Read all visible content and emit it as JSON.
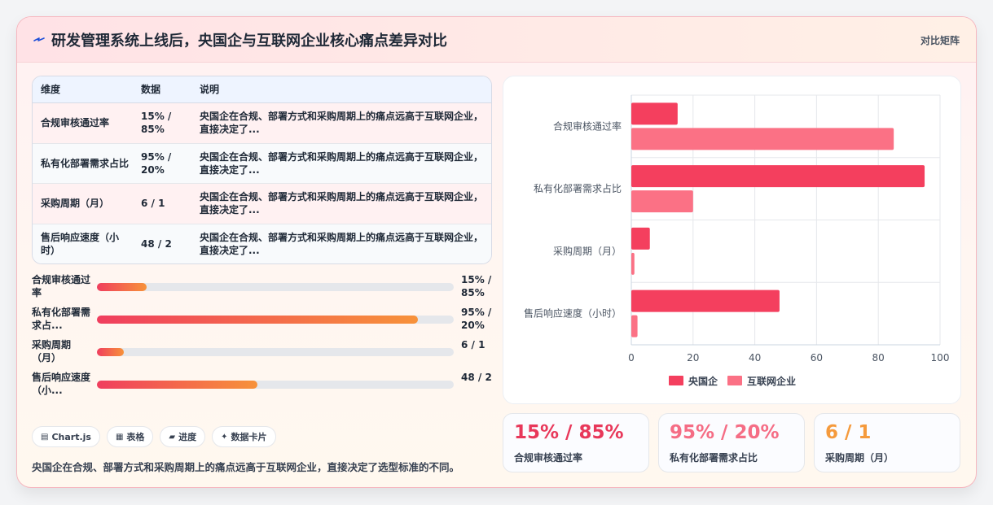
{
  "header": {
    "title": "研发管理系统上线后，央国企与互联网企业核心痛点差异对比",
    "tag": "对比矩阵",
    "title_icon": "lightning-icon"
  },
  "table": {
    "headers": [
      "维度",
      "数据",
      "说明"
    ],
    "rows": [
      {
        "dim": "合规审核通过率",
        "data": "15% / 85%",
        "desc": "央国企在合规、部署方式和采购周期上的痛点远高于互联网企业，直接决定了..."
      },
      {
        "dim": "私有化部署需求占比",
        "data": "95% / 20%",
        "desc": "央国企在合规、部署方式和采购周期上的痛点远高于互联网企业，直接决定了..."
      },
      {
        "dim": "采购周期（月）",
        "data": "6 / 1",
        "desc": "央国企在合规、部署方式和采购周期上的痛点远高于互联网企业，直接决定了..."
      },
      {
        "dim": "售后响应速度（小时）",
        "data": "48 / 2",
        "desc": "央国企在合规、部署方式和采购周期上的痛点远高于互联网企业，直接决定了..."
      }
    ]
  },
  "progress": [
    {
      "label": "合规审核通过率",
      "value": "15% / 85%",
      "fraction": 0.14
    },
    {
      "label": "私有化部署需求占...",
      "value": "95% / 20%",
      "fraction": 0.9
    },
    {
      "label": "采购周期（月）",
      "value": "6 / 1",
      "fraction": 0.075
    },
    {
      "label": "售后响应速度（小...",
      "value": "48 / 2",
      "fraction": 0.45
    }
  ],
  "chips": [
    {
      "icon": "chart-icon",
      "glyph": "▤",
      "label": "Chart.js"
    },
    {
      "icon": "table-icon",
      "glyph": "▦",
      "label": "表格"
    },
    {
      "icon": "folder-icon",
      "glyph": "▰",
      "label": "进度"
    },
    {
      "icon": "sparkle-icon",
      "glyph": "✦",
      "label": "数据卡片"
    }
  ],
  "footnote": "央国企在合规、部署方式和采购周期上的痛点远高于互联网企业，直接决定了选型标准的不同。",
  "stats": [
    {
      "value": "15% / 85%",
      "label": "合规审核通过率",
      "color": "#e8385a"
    },
    {
      "value": "95% / 20%",
      "label": "私有化部署需求占比",
      "color": "#f56d85"
    },
    {
      "value": "6 / 1",
      "label": "采购周期（月）",
      "color": "#f59a3c"
    }
  ],
  "chart_data": {
    "type": "bar",
    "orientation": "horizontal",
    "categories": [
      "合规审核通过率",
      "私有化部署需求占比",
      "采购周期（月）",
      "售后响应速度（小时）"
    ],
    "series": [
      {
        "name": "央国企",
        "values": [
          15,
          95,
          6,
          48
        ],
        "color": "#f43f5e"
      },
      {
        "name": "互联网企业",
        "values": [
          85,
          20,
          1,
          2
        ],
        "color": "#fb7185"
      }
    ],
    "xlim": [
      0,
      100
    ],
    "xticks": [
      0,
      20,
      40,
      60,
      80,
      100
    ],
    "grid": true,
    "legend": "bottom"
  }
}
